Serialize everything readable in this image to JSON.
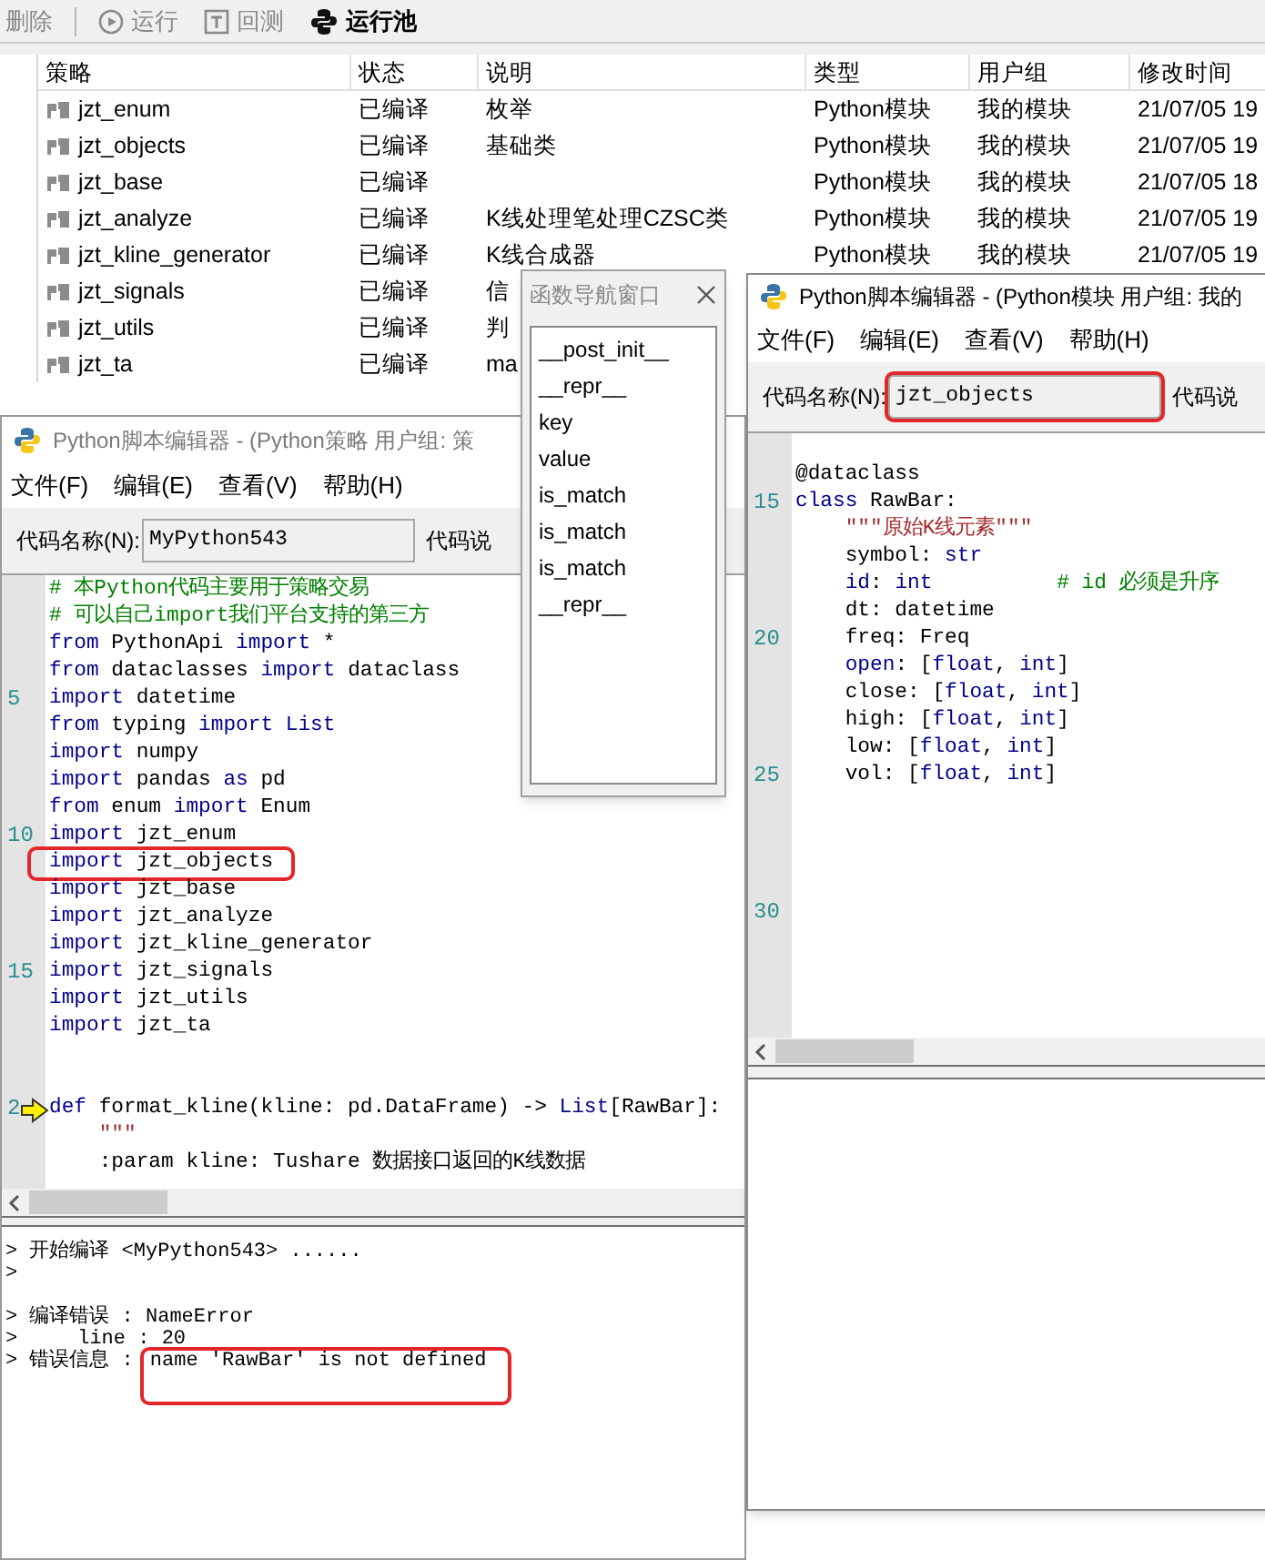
{
  "toolbar": {
    "groups": [
      [
        {
          "kind": "plain",
          "label": "删除",
          "disabled": true
        }
      ],
      [
        {
          "kind": "play",
          "label": "运行",
          "disabled": true
        },
        {
          "kind": "backtest",
          "label": "回测",
          "disabled": true
        },
        {
          "kind": "python",
          "label": "运行池",
          "disabled": false
        }
      ]
    ]
  },
  "table": {
    "columns": [
      "策略",
      "状态",
      "说明",
      "类型",
      "用户组",
      "修改时间"
    ],
    "rows": [
      {
        "cells": [
          "jzt_enum",
          "已编译",
          "枚举",
          "Python模块",
          "我的模块",
          "21/07/05 19"
        ]
      },
      {
        "cells": [
          "jzt_objects",
          "已编译",
          "基础类",
          "Python模块",
          "我的模块",
          "21/07/05 19"
        ]
      },
      {
        "cells": [
          "jzt_base",
          "已编译",
          null,
          "Python模块",
          "我的模块",
          "21/07/05 18"
        ]
      },
      {
        "cells": [
          "jzt_analyze",
          "已编译",
          "K线处理笔处理CZSC类",
          "Python模块",
          "我的模块",
          "21/07/05 19"
        ]
      },
      {
        "cells": [
          "jzt_kline_generator",
          "已编译",
          "K线合成器",
          "Python模块",
          "我的模块",
          "21/07/05 19"
        ]
      },
      {
        "cells": [
          "jzt_signals",
          "已编译",
          "信"
        ]
      },
      {
        "cells": [
          "jzt_utils",
          "已编译",
          "判"
        ]
      },
      {
        "cells": [
          "jzt_ta",
          "已编译",
          "ma"
        ]
      }
    ]
  },
  "left_editor": {
    "title": "Python脚本编辑器 - (Python策略 用户组: 策",
    "active": false,
    "menu": [
      "文件(F)",
      "编辑(E)",
      "查看(V)",
      "帮助(H)"
    ],
    "name_label": "代码名称(N):",
    "name_value": "MyPython543",
    "name_highlighted": false,
    "desc_label": "代码说",
    "lines": [
      {
        "kind": "code",
        "tokens": [
          {
            "kind": "comment",
            "text": "# 本Python代码主要用于策略交易"
          }
        ]
      },
      {
        "kind": "code",
        "tokens": [
          {
            "kind": "comment",
            "text": "# 可以自己import我们平台支持的第三方"
          }
        ]
      },
      {
        "kind": "code",
        "tokens": [
          {
            "kind": "kw",
            "text": "from"
          },
          {
            "kind": "plain",
            "text": " PythonApi "
          },
          {
            "kind": "kw",
            "text": "import"
          },
          {
            "kind": "plain",
            "text": " *"
          }
        ]
      },
      {
        "kind": "code",
        "tokens": [
          {
            "kind": "kw",
            "text": "from"
          },
          {
            "kind": "plain",
            "text": " dataclasses "
          },
          {
            "kind": "kw",
            "text": "import"
          },
          {
            "kind": "plain",
            "text": " dataclass"
          }
        ]
      },
      {
        "kind": "code",
        "number": "5",
        "tokens": [
          {
            "kind": "kw",
            "text": "import"
          },
          {
            "kind": "plain",
            "text": " datetime"
          }
        ]
      },
      {
        "kind": "code",
        "tokens": [
          {
            "kind": "kw",
            "text": "from"
          },
          {
            "kind": "plain",
            "text": " typing "
          },
          {
            "kind": "kw",
            "text": "import"
          },
          {
            "kind": "kw",
            "text": " List"
          }
        ]
      },
      {
        "kind": "code",
        "tokens": [
          {
            "kind": "kw",
            "text": "import"
          },
          {
            "kind": "plain",
            "text": " numpy"
          }
        ]
      },
      {
        "kind": "code",
        "tokens": [
          {
            "kind": "kw",
            "text": "import"
          },
          {
            "kind": "plain",
            "text": " pandas "
          },
          {
            "kind": "kw",
            "text": "as"
          },
          {
            "kind": "plain",
            "text": " pd"
          }
        ]
      },
      {
        "kind": "code",
        "tokens": [
          {
            "kind": "kw",
            "text": "from"
          },
          {
            "kind": "plain",
            "text": " enum "
          },
          {
            "kind": "kw",
            "text": "import"
          },
          {
            "kind": "plain",
            "text": " Enum"
          }
        ]
      },
      {
        "kind": "code",
        "number": "10",
        "tokens": [
          {
            "kind": "kw",
            "text": "import"
          },
          {
            "kind": "plain",
            "text": " jzt_enum"
          }
        ]
      },
      {
        "kind": "code",
        "highlighted": true,
        "tokens": [
          {
            "kind": "kw",
            "text": "import"
          },
          {
            "kind": "plain",
            "text": " jzt_objects"
          }
        ]
      },
      {
        "kind": "code",
        "tokens": [
          {
            "kind": "kw",
            "text": "import"
          },
          {
            "kind": "plain",
            "text": " jzt_base"
          }
        ]
      },
      {
        "kind": "code",
        "tokens": [
          {
            "kind": "kw",
            "text": "import"
          },
          {
            "kind": "plain",
            "text": " jzt_analyze"
          }
        ]
      },
      {
        "kind": "code",
        "tokens": [
          {
            "kind": "kw",
            "text": "import"
          },
          {
            "kind": "plain",
            "text": " jzt_kline_generator"
          }
        ]
      },
      {
        "kind": "code",
        "number": "15",
        "tokens": [
          {
            "kind": "kw",
            "text": "import"
          },
          {
            "kind": "plain",
            "text": " jzt_signals"
          }
        ]
      },
      {
        "kind": "code",
        "tokens": [
          {
            "kind": "kw",
            "text": "import"
          },
          {
            "kind": "plain",
            "text": " jzt_utils"
          }
        ]
      },
      {
        "kind": "code",
        "tokens": [
          {
            "kind": "kw",
            "text": "import"
          },
          {
            "kind": "plain",
            "text": " jzt_ta"
          }
        ]
      },
      {
        "kind": "blank"
      },
      {
        "kind": "blank"
      },
      {
        "kind": "code",
        "number": "2",
        "marker": true,
        "tokens": [
          {
            "kind": "kw",
            "text": "def"
          },
          {
            "kind": "plain",
            "text": " format_kline(kline: pd.DataFrame) -> "
          },
          {
            "kind": "kw",
            "text": "List"
          },
          {
            "kind": "plain",
            "text": "[RawBar]:"
          }
        ]
      },
      {
        "kind": "code",
        "tokens": [
          {
            "kind": "string",
            "text": "    \"\"\""
          }
        ]
      },
      {
        "kind": "code",
        "tokens": [
          {
            "kind": "plain",
            "text": "    :param kline: Tushare 数据接口返回的K线数据"
          }
        ]
      }
    ],
    "output": [
      {
        "kind": "text",
        "text": "> 开始编译 <MyPython543> ......"
      },
      {
        "kind": "text",
        "text": ">"
      },
      {
        "kind": "blank"
      },
      {
        "kind": "text",
        "text": "> 编译错误 : NameError"
      },
      {
        "kind": "text",
        "text": ">     line : 20"
      },
      {
        "kind": "text",
        "text": "> 错误信息 :",
        "message": "name 'RawBar' is not defined",
        "highlighted": true
      }
    ]
  },
  "nav_window": {
    "title": "函数导航窗口",
    "items": [
      "__post_init__",
      "__repr__",
      "key",
      "value",
      "is_match",
      "is_match",
      "is_match",
      "__repr__"
    ]
  },
  "right_editor": {
    "title": "Python脚本编辑器 - (Python模块 用户组: 我的",
    "active": true,
    "menu": [
      "文件(F)",
      "编辑(E)",
      "查看(V)",
      "帮助(H)"
    ],
    "name_label": "代码名称(N):",
    "name_value": "jzt_objects",
    "name_highlighted": true,
    "desc_label": "代码说",
    "lines": [
      {
        "kind": "blank"
      },
      {
        "kind": "code",
        "tokens": [
          {
            "kind": "plain",
            "text": "@dataclass"
          }
        ]
      },
      {
        "kind": "code",
        "number": "15",
        "tokens": [
          {
            "kind": "kw",
            "text": "class"
          },
          {
            "kind": "plain",
            "text": " RawBar:"
          }
        ]
      },
      {
        "kind": "code",
        "tokens": [
          {
            "kind": "string",
            "text": "    \"\"\"原始K线元素\"\"\""
          }
        ]
      },
      {
        "kind": "code",
        "tokens": [
          {
            "kind": "plain",
            "text": "    symbol: "
          },
          {
            "kind": "kw",
            "text": "str"
          }
        ]
      },
      {
        "kind": "code",
        "tokens": [
          {
            "kind": "kw",
            "text": "    id"
          },
          {
            "kind": "plain",
            "text": ": "
          },
          {
            "kind": "kw",
            "text": "int          "
          },
          {
            "kind": "comment",
            "text": "# id 必须是升序"
          }
        ]
      },
      {
        "kind": "code",
        "tokens": [
          {
            "kind": "plain",
            "text": "    dt: datetime"
          }
        ]
      },
      {
        "kind": "code",
        "number": "20",
        "tokens": [
          {
            "kind": "plain",
            "text": "    freq: Freq"
          }
        ]
      },
      {
        "kind": "code",
        "tokens": [
          {
            "kind": "kw",
            "text": "    open"
          },
          {
            "kind": "plain",
            "text": ": ["
          },
          {
            "kind": "kw",
            "text": "float"
          },
          {
            "kind": "plain",
            "text": ", "
          },
          {
            "kind": "kw",
            "text": "int"
          },
          {
            "kind": "plain",
            "text": "]"
          }
        ]
      },
      {
        "kind": "code",
        "tokens": [
          {
            "kind": "plain",
            "text": "    close: ["
          },
          {
            "kind": "kw",
            "text": "float"
          },
          {
            "kind": "plain",
            "text": ", "
          },
          {
            "kind": "kw",
            "text": "int"
          },
          {
            "kind": "plain",
            "text": "]"
          }
        ]
      },
      {
        "kind": "code",
        "tokens": [
          {
            "kind": "plain",
            "text": "    high: ["
          },
          {
            "kind": "kw",
            "text": "float"
          },
          {
            "kind": "plain",
            "text": ", "
          },
          {
            "kind": "kw",
            "text": "int"
          },
          {
            "kind": "plain",
            "text": "]"
          }
        ]
      },
      {
        "kind": "code",
        "tokens": [
          {
            "kind": "plain",
            "text": "    low: ["
          },
          {
            "kind": "kw",
            "text": "float"
          },
          {
            "kind": "plain",
            "text": ", "
          },
          {
            "kind": "kw",
            "text": "int"
          },
          {
            "kind": "plain",
            "text": "]"
          }
        ]
      },
      {
        "kind": "code",
        "number": "25",
        "tokens": [
          {
            "kind": "plain",
            "text": "    vol: ["
          },
          {
            "kind": "kw",
            "text": "float"
          },
          {
            "kind": "plain",
            "text": ", "
          },
          {
            "kind": "kw",
            "text": "int"
          },
          {
            "kind": "plain",
            "text": "]"
          }
        ]
      },
      {
        "kind": "blank"
      },
      {
        "kind": "blank"
      },
      {
        "kind": "blank"
      },
      {
        "kind": "blank"
      },
      {
        "kind": "blank",
        "number": "30"
      },
      {
        "kind": "blank"
      },
      {
        "kind": "blank"
      },
      {
        "kind": "blank"
      }
    ]
  }
}
